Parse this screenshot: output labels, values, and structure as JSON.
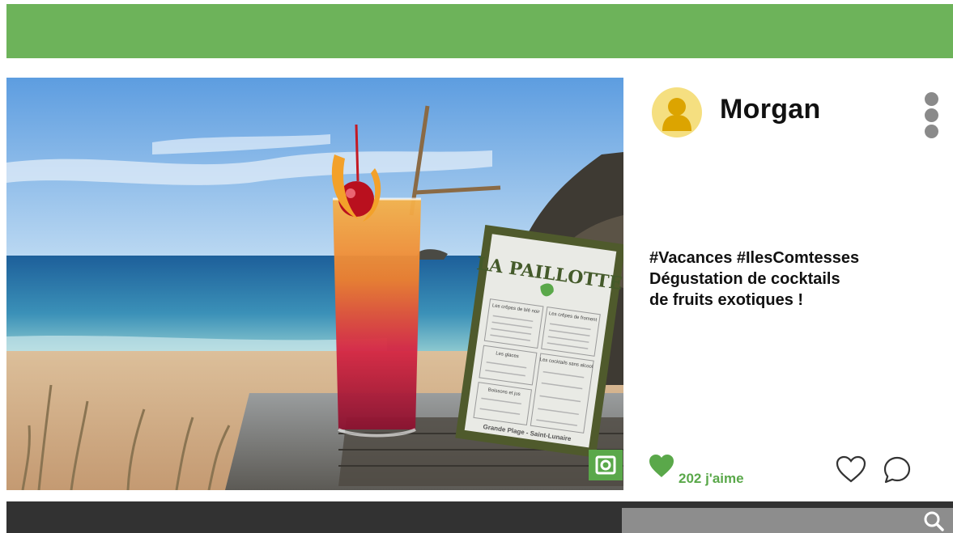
{
  "header": {
    "color": "#6db35a"
  },
  "post": {
    "image": {
      "menu_title": "LA PAILLOTTE",
      "menu_footer": "Grande Plage - Saint-Lunaire",
      "menu_sections": {
        "crepes_ble_noir": "Les crêpes de blé noir",
        "crepes_froment": "Les crêpes de froment",
        "glaces": "Les glaces",
        "cocktails_sans_alcool": "Les cocktails sans alcool",
        "boissons": "Boissons et jus"
      }
    },
    "author": {
      "name": "Morgan",
      "avatar_icon": "user-avatar-icon"
    },
    "caption_lines": [
      "#Vacances #IlesComtesses",
      "Dégustation de cocktails",
      "de fruits exotiques !"
    ],
    "likes_text": "202 j'aime",
    "accent_color": "#5aa84a"
  },
  "icons": {
    "more": "more-vertical-icon",
    "camera": "camera-icon",
    "like_filled": "heart-filled-icon",
    "like": "heart-outline-icon",
    "comment": "comment-icon",
    "search": "search-icon"
  },
  "search": {
    "placeholder": ""
  }
}
